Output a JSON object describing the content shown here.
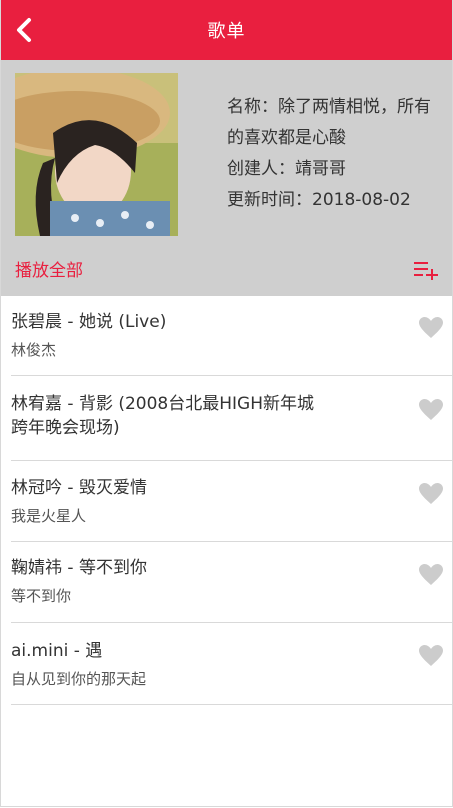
{
  "nav": {
    "title": "歌单",
    "back_icon": "chevron-left-icon"
  },
  "playlist": {
    "name_line1": "名称：除了两情相悦，所有",
    "name_line2": "的喜欢都是心酸",
    "creator": "创建人：靖哥哥",
    "updated": "更新时间：2018-08-02"
  },
  "actions": {
    "play_all": "播放全部",
    "add_icon": "playlist-add-icon"
  },
  "songs": [
    {
      "title": "张碧晨 - 她说 (Live)",
      "subtitle": "林俊杰"
    },
    {
      "title_line1": "林宥嘉 - 背影 (2008台北最HIGH新年城",
      "title_line2": "跨年晚会现场)"
    },
    {
      "title": "林冠吟 - 毁灭爱情",
      "subtitle": "我是火星人"
    },
    {
      "title": "鞠婧祎 - 等不到你",
      "subtitle": "等不到你"
    },
    {
      "title": "ai.mini - 遇",
      "subtitle": "自从见到你的那天起"
    }
  ],
  "colors": {
    "accent": "#e91f3f",
    "header_bg": "#cfcfcf",
    "heart": "#cccccc"
  }
}
